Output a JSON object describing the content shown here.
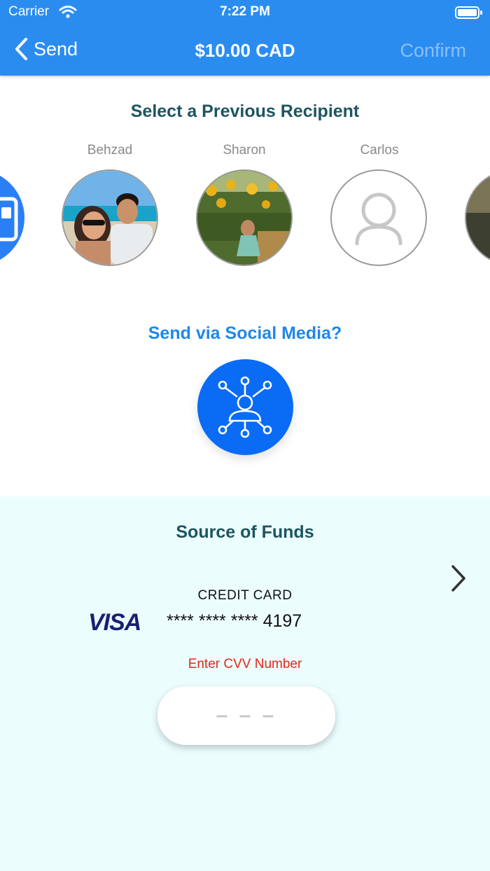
{
  "status_bar": {
    "carrier": "Carrier",
    "time": "7:22 PM"
  },
  "nav": {
    "back_label": "Send",
    "title": "$10.00 CAD",
    "confirm_label": "Confirm"
  },
  "recipients": {
    "title": "Select a Previous Recipient",
    "items": [
      {
        "name": "Behzad"
      },
      {
        "name": "Sharon"
      },
      {
        "name": "Carlos"
      }
    ]
  },
  "social": {
    "title": "Send via Social Media?",
    "icon": "social-network-icon"
  },
  "funds": {
    "title": "Source of Funds",
    "card_type": "CREDIT CARD",
    "card_brand": "VISA",
    "card_number": "**** **** **** 4197",
    "cvv_label": "Enter CVV Number",
    "cvv_placeholder": "– – –",
    "cvv_value": ""
  },
  "colors": {
    "header": "#2b8cf0",
    "accent": "#0a6bf5",
    "section_title": "#1d5560",
    "error": "#e8261a",
    "funds_background": "#ecfdfe"
  }
}
